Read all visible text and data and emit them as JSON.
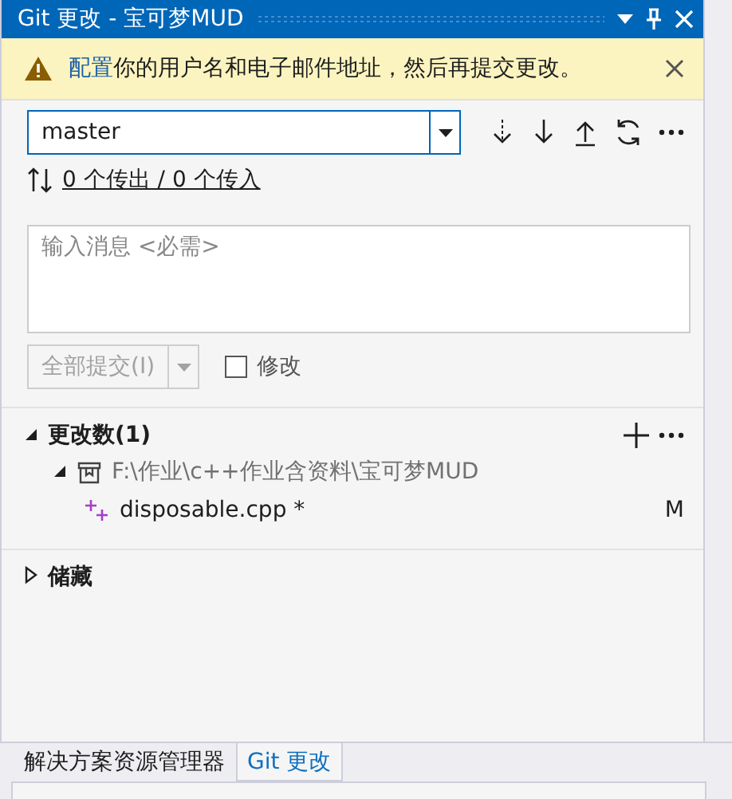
{
  "window": {
    "title": "Git 更改 - 宝可梦MUD"
  },
  "info_bar": {
    "link": "配置",
    "message": "你的用户名和电子邮件地址，然后再提交更改。"
  },
  "branch": {
    "value": "master"
  },
  "sync": {
    "summary": "0 个传出 / 0 个传入"
  },
  "message": {
    "placeholder": "输入消息 <必需>"
  },
  "commit": {
    "label": "全部提交(I)",
    "disabled": true
  },
  "amend": {
    "label": "修改",
    "checked": false
  },
  "sections": [
    {
      "title": "更改数(1)",
      "expanded": true,
      "children": [
        {
          "kind": "repo",
          "label": "F:\\作业\\c++作业含资料\\宝可梦MUD",
          "expanded": true,
          "children": [
            {
              "kind": "file",
              "label": "disposable.cpp *",
              "status": "M"
            }
          ]
        }
      ]
    },
    {
      "title": "储藏",
      "expanded": false
    }
  ],
  "tabs": [
    {
      "label": "解决方案资源管理器",
      "selected": false
    },
    {
      "label": "Git 更改",
      "selected": true
    }
  ]
}
